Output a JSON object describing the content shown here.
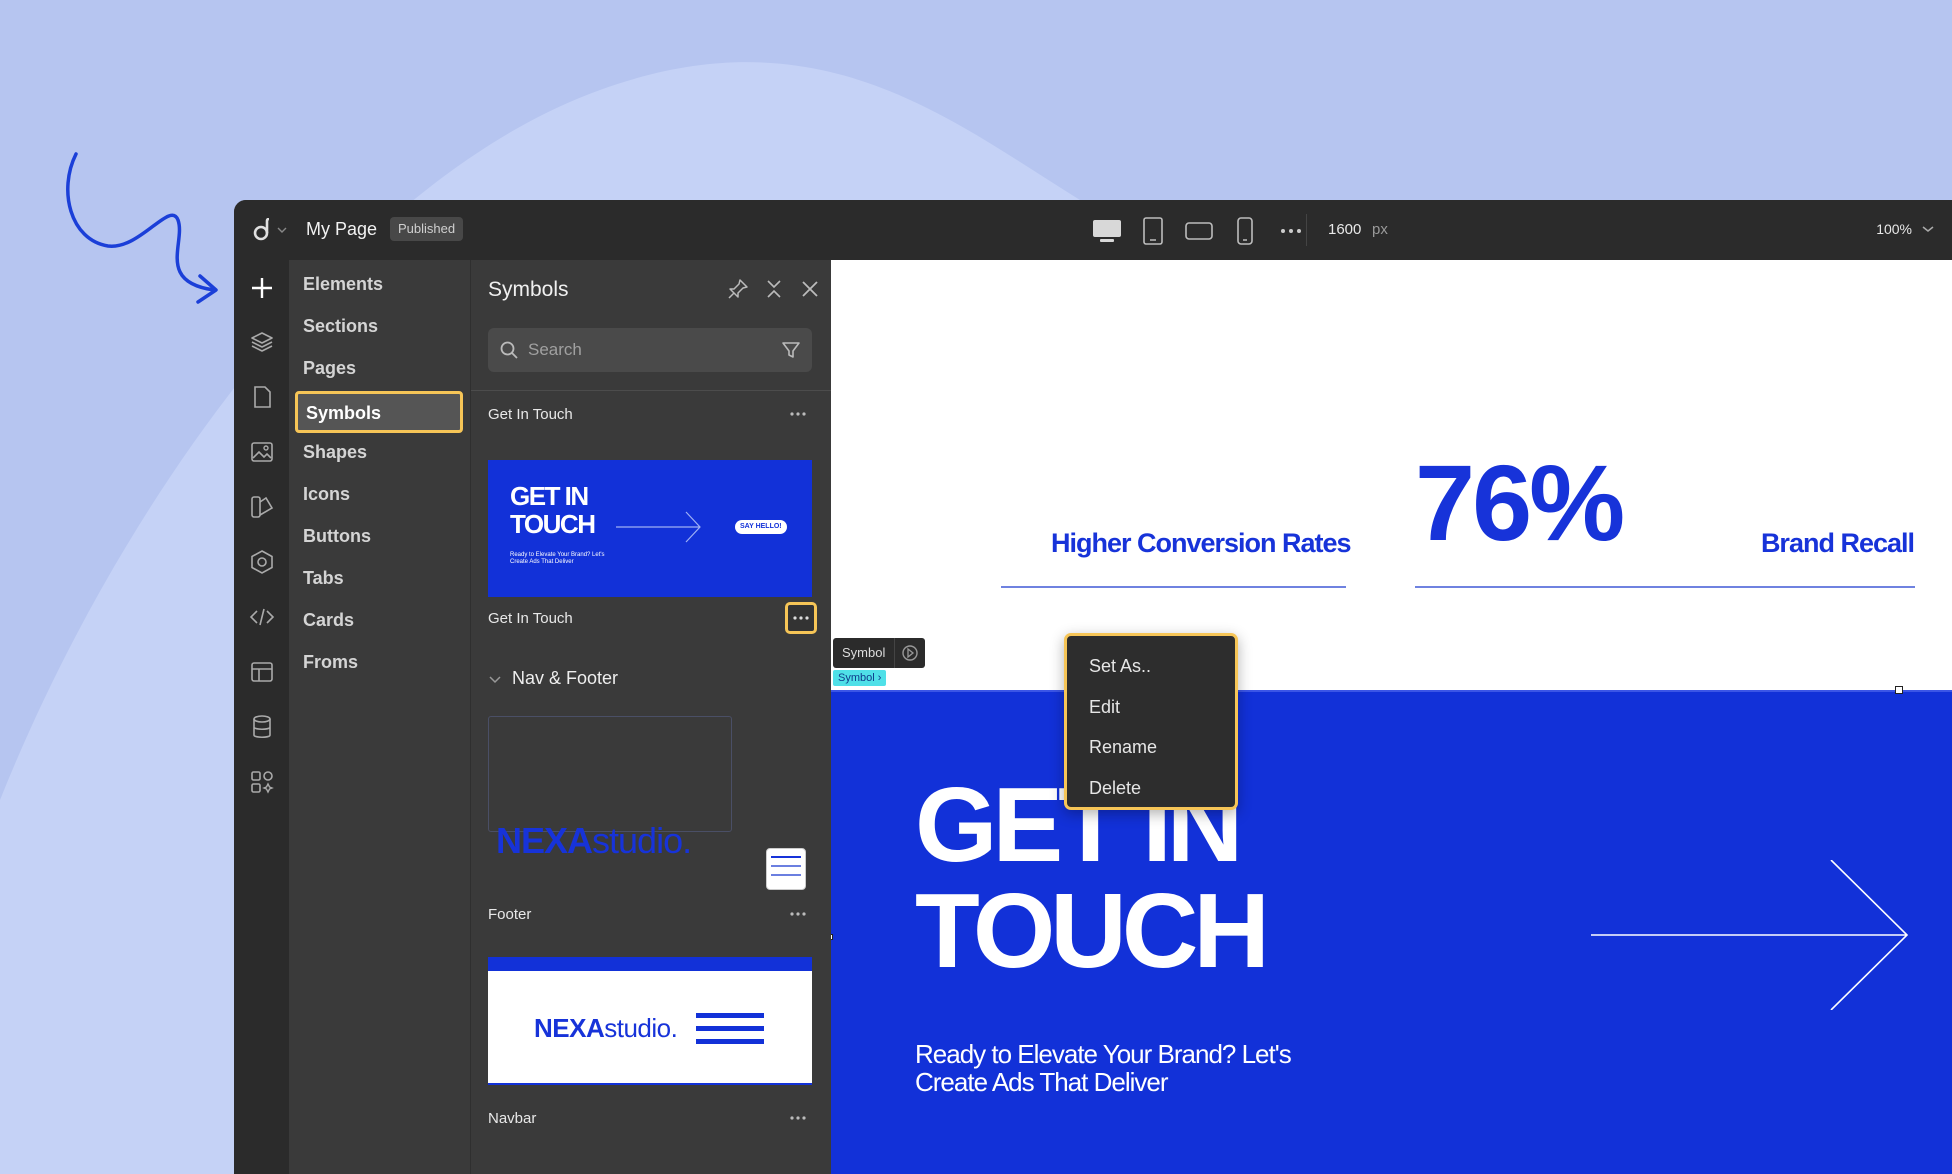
{
  "app": {
    "page_name": "My Page",
    "status_badge": "Published",
    "width_value": "1600",
    "width_unit": "px",
    "zoom": "100%"
  },
  "categories": [
    "Elements",
    "Sections",
    "Pages",
    "Symbols",
    "Shapes",
    "Icons",
    "Buttons",
    "Tabs",
    "Cards",
    "Froms"
  ],
  "panel": {
    "title": "Symbols",
    "search_placeholder": "Search",
    "items": [
      {
        "label": "Get In Touch"
      },
      {
        "label": "Get In Touch"
      },
      {
        "label": "Footer"
      },
      {
        "label": "Navbar"
      }
    ],
    "group": "Nav & Footer",
    "thumb_get_in_touch": {
      "title_line1": "GET IN",
      "title_line2": "TOUCH",
      "badge": "SAY HELLO!",
      "sub": "Ready to Elevate Your Brand? Let's Create Ads That Deliver"
    },
    "thumb_brand": {
      "bold": "NEXA",
      "light": "studio."
    },
    "thumb_brand_nav": {
      "bold": "NEXA",
      "light": "studio."
    }
  },
  "context_menu": [
    "Set As..",
    "Edit",
    "Rename",
    "Delete"
  ],
  "canvas": {
    "stat1_label": "Higher Conversion Rates",
    "big_number": "76%",
    "stat2_label": "Brand Recall",
    "hero_line1": "GET IN",
    "hero_line2": "TOUCH",
    "hero_sub_line1": "Ready to Elevate Your Brand? Let's",
    "hero_sub_line2": "Create Ads That Deliver",
    "selection_tag": "Symbol",
    "breadcrumb": "Symbol ›"
  },
  "colors": {
    "accent": "#f6c557",
    "brand_blue": "#1231d8",
    "background": "#b6c5f0"
  }
}
